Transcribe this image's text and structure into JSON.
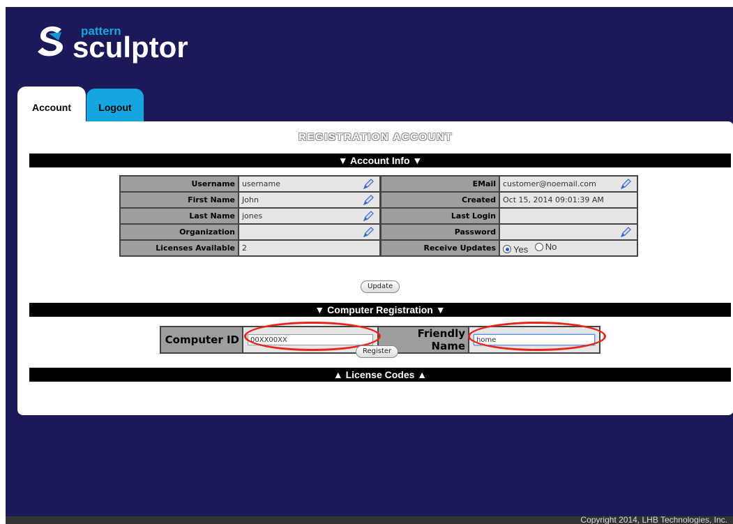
{
  "brand": {
    "logo_small": "pattern",
    "logo_big": "sculptor",
    "primary_color": "#1c1958",
    "accent_color": "#15a6e0"
  },
  "tabs": [
    {
      "label": "Account",
      "active": true
    },
    {
      "label": "Logout",
      "active": false
    }
  ],
  "page_title": "REGISTRATION ACCOUNT",
  "account_section": {
    "header": "▼ Account Info ▼",
    "left_rows": [
      {
        "label": "Username",
        "value": "username",
        "editable": true
      },
      {
        "label": "First Name",
        "value": "John",
        "editable": true
      },
      {
        "label": "Last Name",
        "value": "jones",
        "editable": true
      },
      {
        "label": "Organization",
        "value": "",
        "editable": true
      },
      {
        "label": "Licenses Available",
        "value": "2",
        "editable": false
      }
    ],
    "right_rows": [
      {
        "label": "EMail",
        "value": "customer@noemail.com",
        "editable": true
      },
      {
        "label": "Created",
        "value": "Oct 15, 2014 09:01:39 AM",
        "editable": false
      },
      {
        "label": "Last Login",
        "value": "",
        "editable": false
      },
      {
        "label": "Password",
        "value": "",
        "editable": true
      },
      {
        "label": "Receive Updates",
        "value": "",
        "editable": false
      }
    ],
    "receive_updates": {
      "options": [
        "Yes",
        "No"
      ],
      "selected": "Yes"
    },
    "update_button": "Update"
  },
  "computer_section": {
    "header": "▼ Computer Registration ▼",
    "computer_id_label": "Computer ID",
    "computer_id_value": "00XX00XX",
    "friendly_name_label": "Friendly Name",
    "friendly_name_value": "home",
    "register_button": "Register"
  },
  "license_section": {
    "header": "▲ License Codes ▲"
  },
  "footer": "Copyright 2014, LHB Technologies, Inc."
}
